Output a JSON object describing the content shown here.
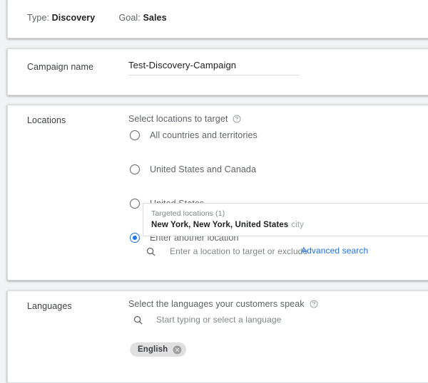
{
  "summary": {
    "type_label": "Type:",
    "type_value": "Discovery",
    "goal_label": "Goal:",
    "goal_value": "Sales"
  },
  "campaign_name": {
    "label": "Campaign name",
    "value": "Test-Discovery-Campaign"
  },
  "locations": {
    "label": "Locations",
    "heading": "Select locations to target",
    "help_icon": "help-circle-icon",
    "options": [
      {
        "label": "All countries and territories",
        "selected": false
      },
      {
        "label": "United States and Canada",
        "selected": false
      },
      {
        "label": "United States",
        "selected": false
      },
      {
        "label": "Enter another location",
        "selected": true
      }
    ],
    "targeted": {
      "title": "Targeted locations (1)",
      "items": [
        {
          "name": "New York, New York, United States",
          "kind": "city"
        }
      ]
    },
    "search_icon": "search-icon",
    "search_placeholder": "Enter a location to target or exclude",
    "advanced_search": "Advanced search"
  },
  "languages": {
    "label": "Languages",
    "heading": "Select the languages your customers speak",
    "help_icon": "help-circle-icon",
    "search_icon": "search-icon",
    "search_placeholder": "Start typing or select a language",
    "chips": [
      {
        "label": "English",
        "remove_icon": "close-circle-icon"
      }
    ]
  },
  "colors": {
    "accent": "#1a73e8",
    "page_background": "#f1f3f4",
    "card_background": "#ffffff",
    "border": "#dadce0",
    "text_primary": "#202124",
    "text_secondary": "#5f6368",
    "chip_background": "#e0e0e0"
  }
}
